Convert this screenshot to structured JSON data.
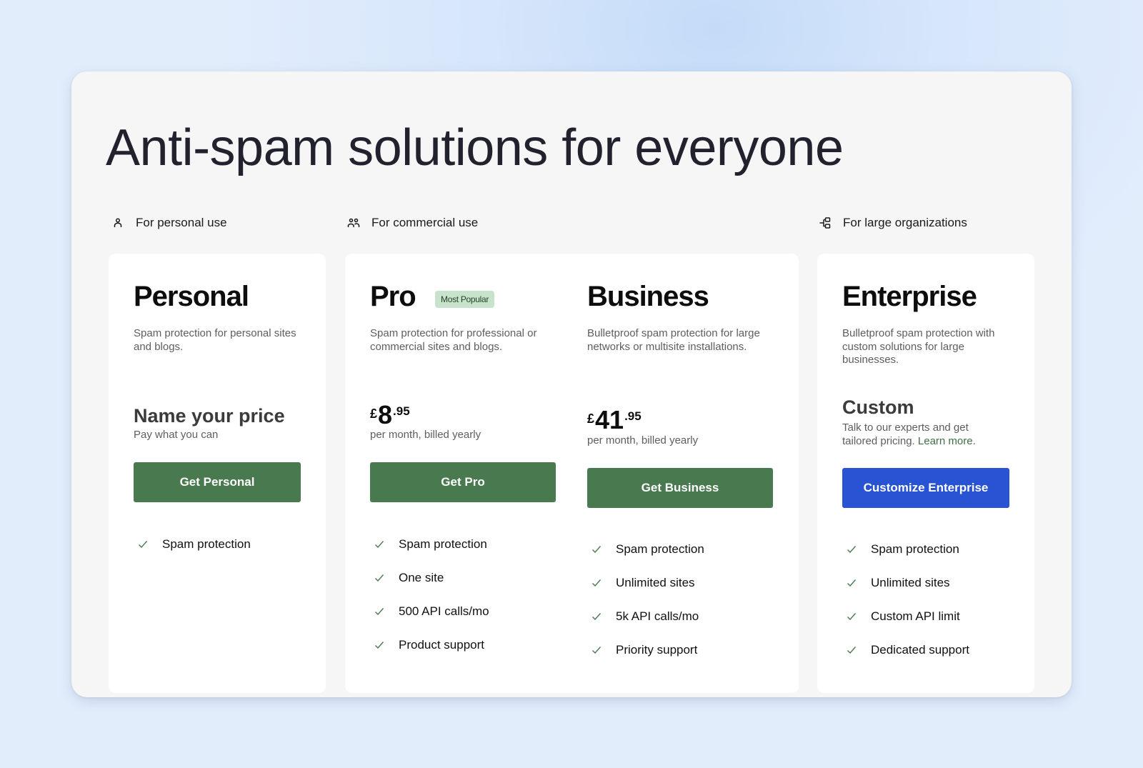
{
  "headline": "Anti-spam solutions for everyone",
  "colors": {
    "accent_green": "#497a4f",
    "accent_blue": "#2853d3",
    "badge_bg": "#c8e3cc",
    "link_green": "#3f6e48"
  },
  "categories": [
    {
      "label": "For personal use",
      "icon": "person-icon"
    },
    {
      "label": "For commercial use",
      "icon": "people-icon"
    },
    {
      "label": "For large organizations",
      "icon": "organization-icon"
    }
  ],
  "plans": [
    {
      "name": "Personal",
      "description": "Spam protection for personal sites and blogs.",
      "price_label": "Name your price",
      "price_sub": "Pay what you can",
      "cta": "Get Personal",
      "features": [
        "Spam protection"
      ]
    },
    {
      "name": "Pro",
      "badge": "Most Popular",
      "description": "Spam protection for professional or commercial sites and blogs.",
      "price": {
        "currency": "£",
        "whole": "8",
        "cents": ".95"
      },
      "price_sub": "per month, billed yearly",
      "cta": "Get Pro",
      "features": [
        "Spam protection",
        "One site",
        "500 API calls/mo",
        "Product support"
      ]
    },
    {
      "name": "Business",
      "description": "Bulletproof spam protection for large networks or multisite installations.",
      "price": {
        "currency": "£",
        "whole": "41",
        "cents": ".95"
      },
      "price_sub": "per month, billed yearly",
      "cta": "Get Business",
      "features": [
        "Spam protection",
        "Unlimited sites",
        "5k API calls/mo",
        "Priority support"
      ]
    },
    {
      "name": "Enterprise",
      "description": "Bulletproof spam protection with custom solutions for large businesses.",
      "price_label": "Custom",
      "price_sub": "Talk to our experts and get tailored pricing.",
      "learn_more": "Learn more.",
      "cta": "Customize Enterprise",
      "features": [
        "Spam protection",
        "Unlimited sites",
        "Custom API limit",
        "Dedicated support"
      ]
    }
  ]
}
